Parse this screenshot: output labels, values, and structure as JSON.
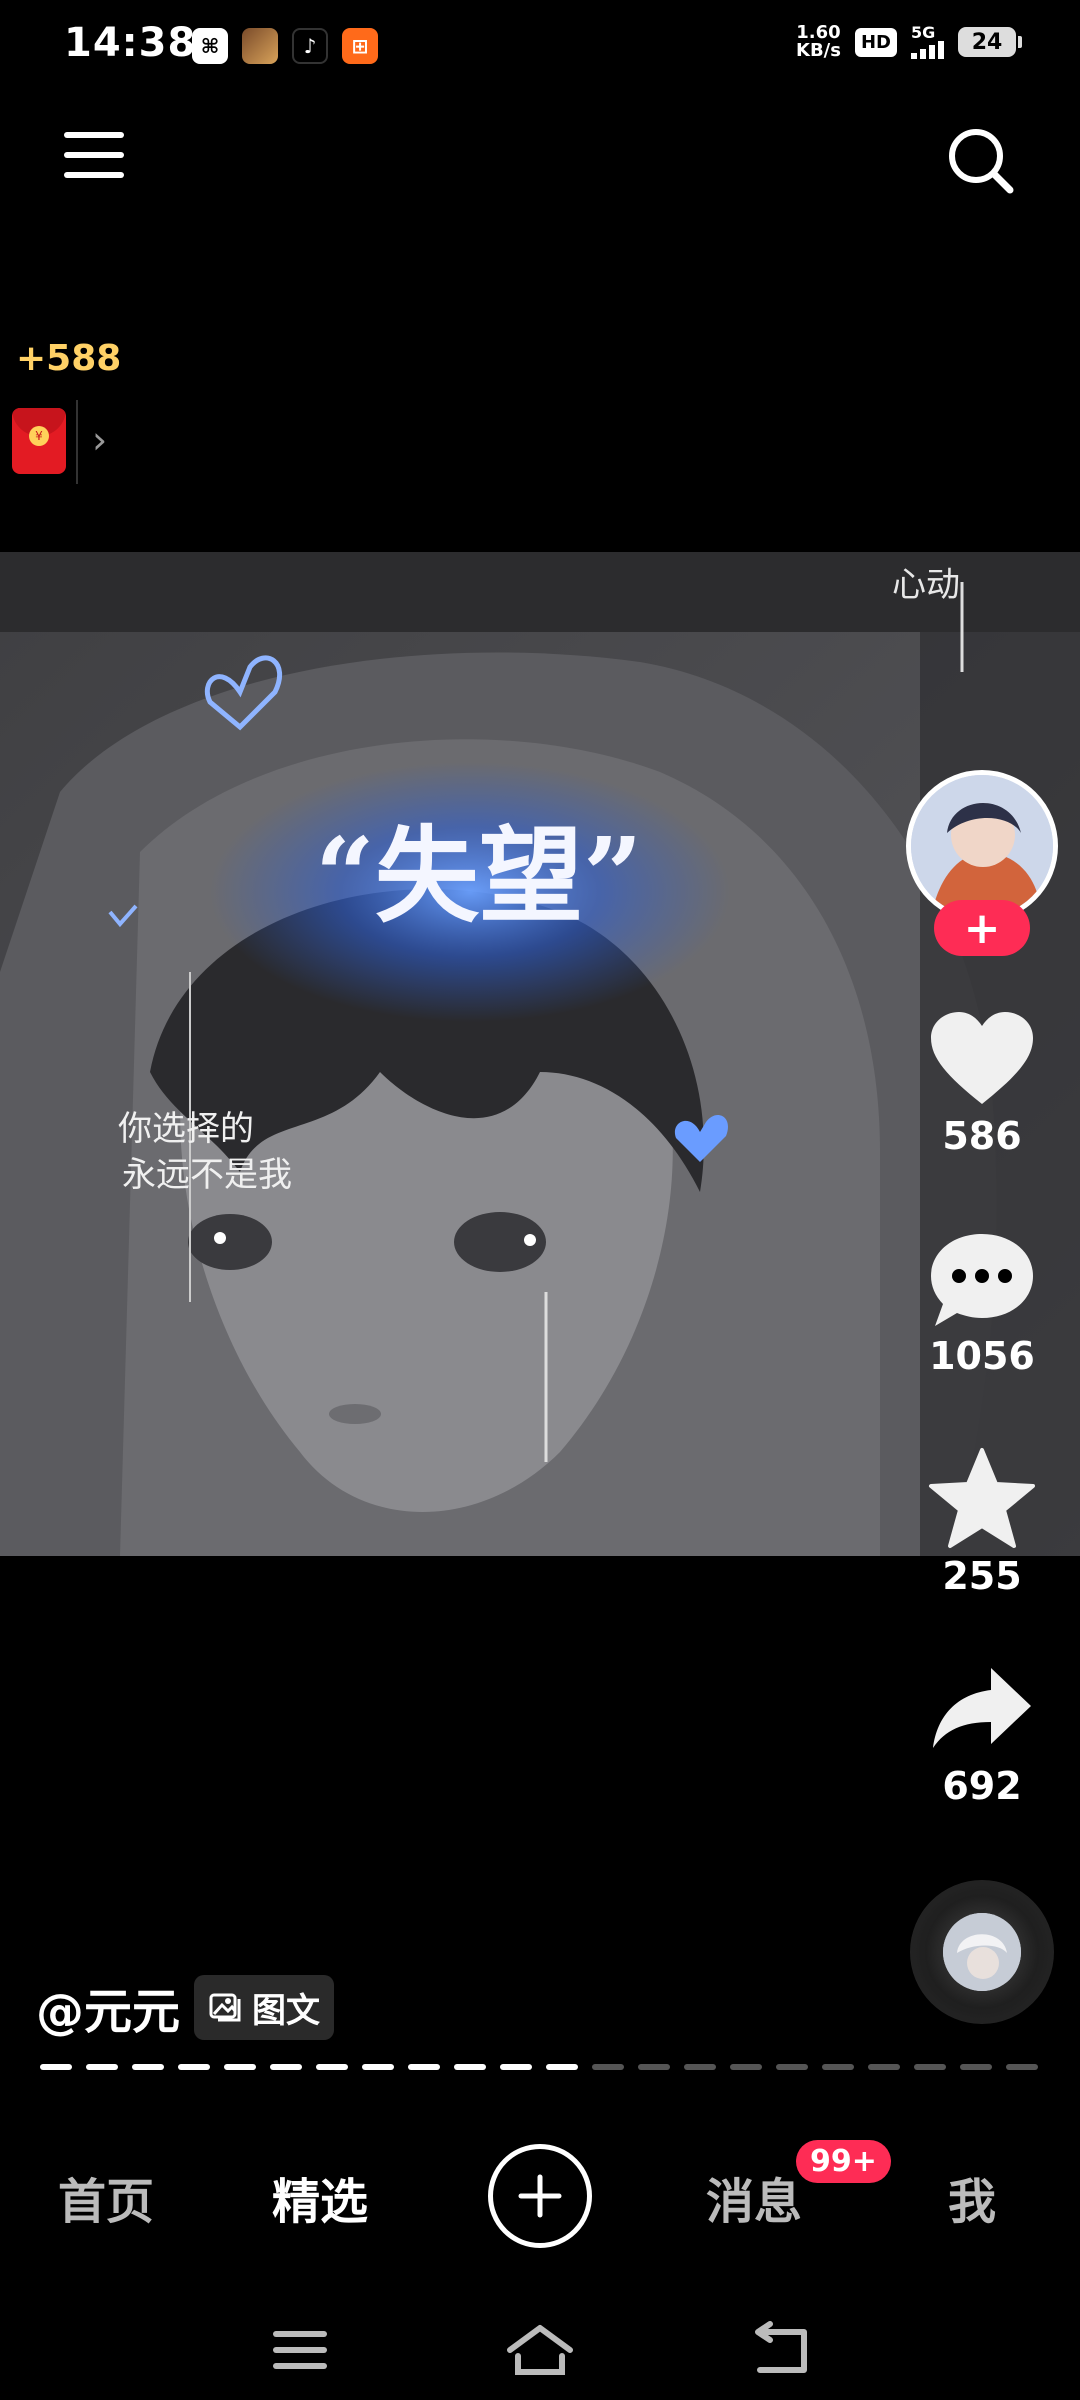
{
  "status_bar": {
    "time": "14:38",
    "net_speed_value": "1.60",
    "net_speed_unit": "KB/s",
    "hd": "HD",
    "network": "5G",
    "battery": "24"
  },
  "reward": {
    "amount": "+588"
  },
  "post": {
    "image_caption_title": "“失望”",
    "image_caption_line1": "你选择的",
    "image_caption_line2": "永远不是我",
    "image_corner_text": "心动",
    "author": "@元元",
    "type_label": "图文",
    "slides_total": 22,
    "slides_viewed": 12
  },
  "actions": {
    "likes": "586",
    "comments": "1056",
    "favorites": "255",
    "shares": "692"
  },
  "tabs": [
    {
      "label": "首页",
      "active": false
    },
    {
      "label": "精选",
      "active": true
    },
    {
      "label": "消息",
      "active": false
    },
    {
      "label": "我",
      "active": false
    }
  ],
  "messages_badge": "99+",
  "colors": {
    "accent": "#fe2c55",
    "reward": "#ffd166",
    "background": "#000000"
  }
}
